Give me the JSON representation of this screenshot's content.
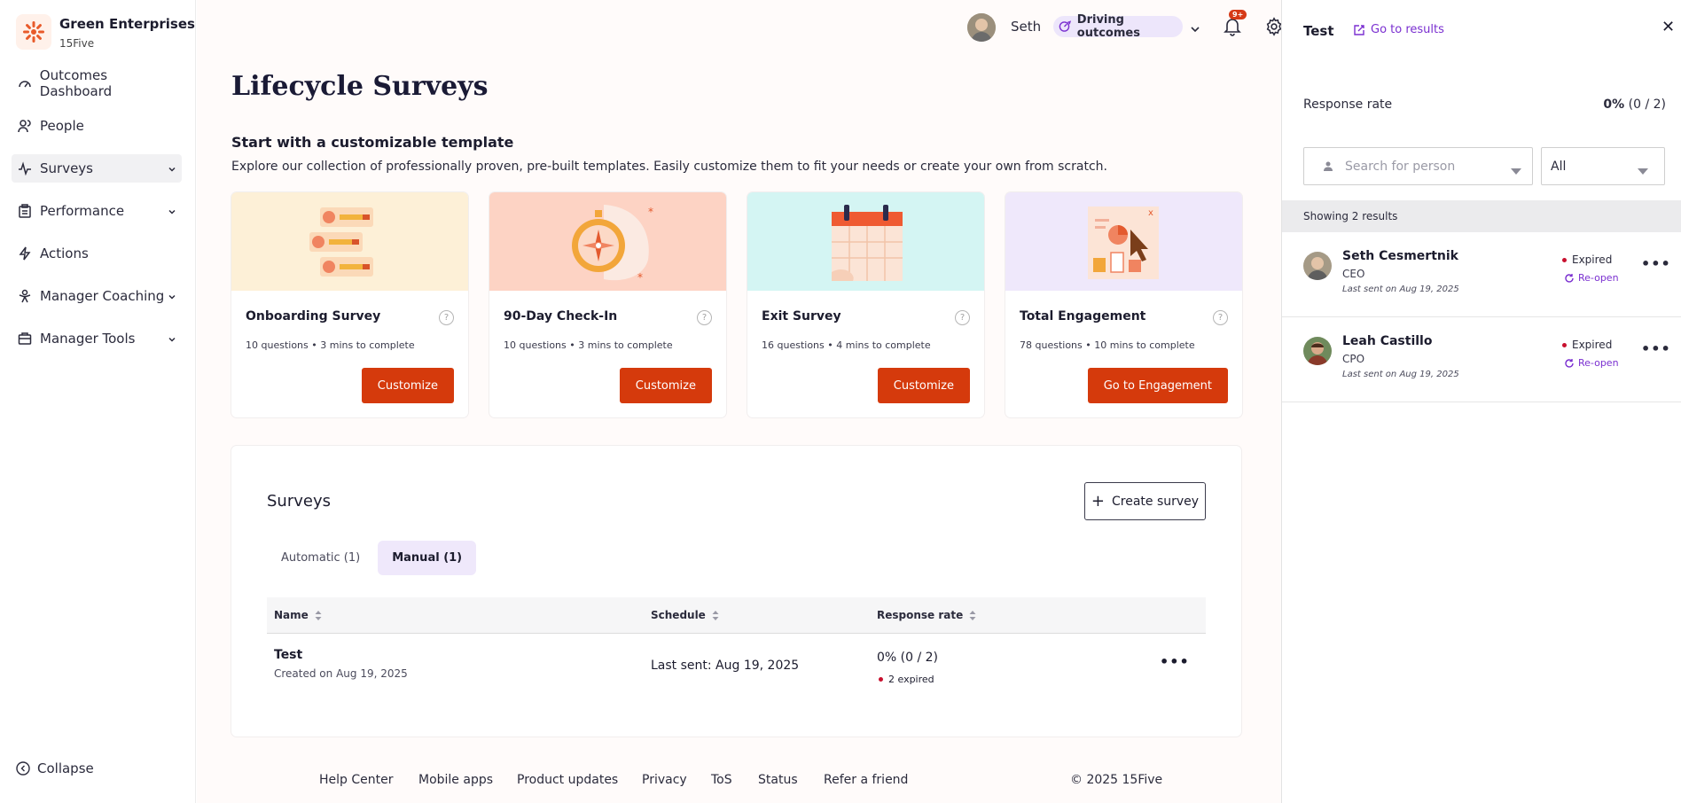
{
  "org": {
    "name": "Green Enterprises",
    "sub": "15Five",
    "logo_icon": "fifteen-five-logo-icon",
    "accent": "#e85a2a"
  },
  "sidebar": {
    "items": [
      {
        "label": "Outcomes Dashboard",
        "icon": "gauge-icon",
        "chevron": false,
        "active": false
      },
      {
        "label": "People",
        "icon": "people-icon",
        "chevron": false,
        "active": false
      },
      {
        "label": "Surveys",
        "icon": "pulse-icon",
        "chevron": true,
        "active": true
      },
      {
        "label": "Performance",
        "icon": "clipboard-icon",
        "chevron": true,
        "active": false
      },
      {
        "label": "Actions",
        "icon": "bolt-icon",
        "chevron": false,
        "active": false
      },
      {
        "label": "Manager Coaching",
        "icon": "coaching-icon",
        "chevron": true,
        "active": false
      },
      {
        "label": "Manager Tools",
        "icon": "toolbox-icon",
        "chevron": true,
        "active": false
      }
    ],
    "collapse_label": "Collapse"
  },
  "topbar": {
    "user_name": "Seth",
    "chip_label": "Driving outcomes",
    "notifications_badge": "9+"
  },
  "page": {
    "title": "Lifecycle Surveys",
    "template_title": "Start with a customizable template",
    "template_desc": "Explore our collection of professionally proven, pre-built templates. Easily customize them to fit your needs or create your own from scratch."
  },
  "templates": [
    {
      "title": "Onboarding Survey",
      "meta": "10 questions • 3 mins to complete",
      "button": "Customize",
      "bg": "#fdf0d7"
    },
    {
      "title": "90-Day Check-In",
      "meta": "10 questions • 3 mins to complete",
      "button": "Customize",
      "bg": "#fdd3c4"
    },
    {
      "title": "Exit Survey",
      "meta": "16 questions • 4 mins to complete",
      "button": "Customize",
      "bg": "#d4f5f3"
    },
    {
      "title": "Total Engagement",
      "meta": "78 questions • 10 mins to complete",
      "button": "Go to Engagement",
      "bg": "#efe8fb"
    }
  ],
  "surveys": {
    "title": "Surveys",
    "create_label": "Create survey",
    "tabs": [
      {
        "label": "Automatic (1)",
        "active": false
      },
      {
        "label": "Manual (1)",
        "active": true
      }
    ],
    "columns": [
      "Name",
      "Schedule",
      "Response rate"
    ],
    "rows": [
      {
        "name": "Test",
        "created": "Created on Aug 19, 2025",
        "schedule": "Last sent: Aug 19, 2025",
        "rate": "0% (0 / 2)",
        "expired": "2 expired"
      }
    ]
  },
  "footer": {
    "links": [
      "Help Center",
      "Mobile apps",
      "Product updates",
      "Privacy",
      "ToS",
      "Status",
      "Refer a friend"
    ],
    "copyright": "© 2025 15Five"
  },
  "drawer": {
    "title": "Test",
    "link": "Go to results",
    "response_label": "Response rate",
    "response_pct": "0%",
    "response_count": "(0 / 2)",
    "search_placeholder": "Search for person",
    "filter_value": "All",
    "showing": "Showing 2 results",
    "people": [
      {
        "name": "Seth Cesmertnik",
        "role": "CEO",
        "sent": "Last sent on Aug 19, 2025",
        "status": "Expired",
        "action": "Re-open"
      },
      {
        "name": "Leah Castillo",
        "role": "CPO",
        "sent": "Last sent on Aug 19, 2025",
        "status": "Expired",
        "action": "Re-open"
      }
    ]
  }
}
